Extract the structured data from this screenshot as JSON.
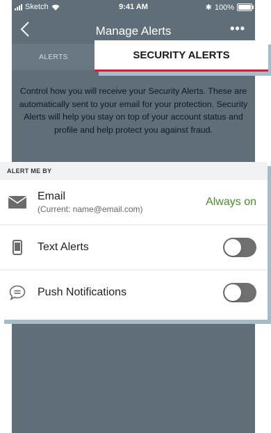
{
  "status_bar": {
    "carrier": "Sketch",
    "time": "9:41 AM",
    "battery": "100%"
  },
  "nav": {
    "back_icon": "chevron-left-icon",
    "title": "Manage Alerts",
    "more_label": "•••"
  },
  "tabs": [
    {
      "label": "ALERTS",
      "selected": false
    },
    {
      "label": "SECURITY ALERTS",
      "selected": true
    }
  ],
  "description": "Control how you will receive your Security Alerts. These are automatically sent to your email for your protection. Security Alerts will help you stay on top of your account status and profile and help protect you against fraud.",
  "alert_me_by": {
    "header": "ALERT ME BY",
    "rows": [
      {
        "icon": "envelope-icon",
        "label": "Email",
        "sublabel": "(Current: name@email.com)",
        "status": "Always on"
      },
      {
        "icon": "phone-icon",
        "label": "Text Alerts",
        "toggle_on": false
      },
      {
        "icon": "chat-bubble-icon",
        "label": "Push Notifications",
        "toggle_on": false
      }
    ]
  },
  "colors": {
    "accent_red": "#d81e2b",
    "status_green": "#4a8a2e",
    "toggle_off": "#6f6f6f"
  }
}
